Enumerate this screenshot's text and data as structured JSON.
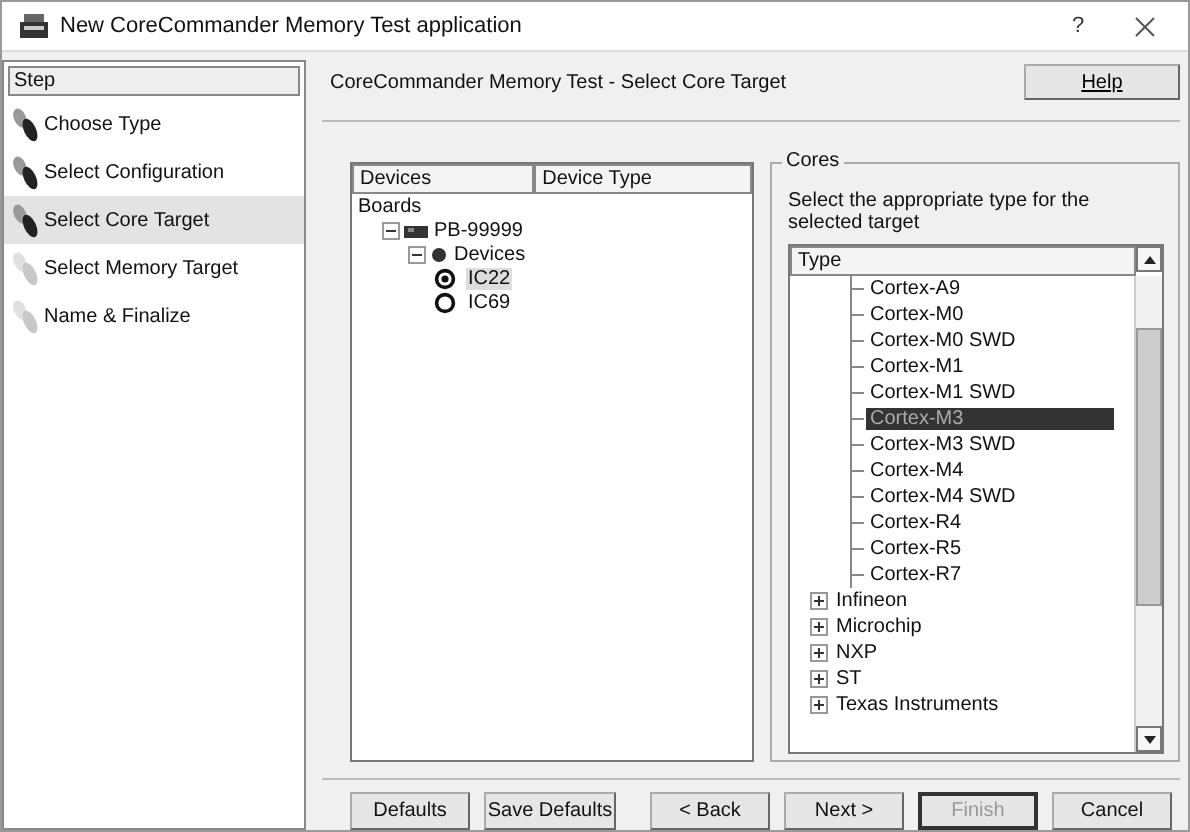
{
  "window": {
    "title": "New CoreCommander Memory Test application",
    "help_button": "?"
  },
  "steps": {
    "header": "Step",
    "items": [
      {
        "label": "Choose Type",
        "selected": false,
        "reached": true
      },
      {
        "label": "Select Configuration",
        "selected": false,
        "reached": true
      },
      {
        "label": "Select Core Target",
        "selected": true,
        "reached": true
      },
      {
        "label": "Select Memory Target",
        "selected": false,
        "reached": false
      },
      {
        "label": "Name & Finalize",
        "selected": false,
        "reached": false
      }
    ]
  },
  "page": {
    "title": "CoreCommander Memory Test - Select Core Target",
    "help": "Help"
  },
  "devices": {
    "columns": [
      "Devices",
      "Device Type"
    ],
    "tree": [
      {
        "label": "Boards",
        "kind": "root",
        "children": [
          {
            "label": "PB-99999",
            "kind": "board",
            "expanded": true,
            "children": [
              {
                "label": "Devices",
                "kind": "group",
                "expanded": true,
                "children": [
                  {
                    "label": "IC22",
                    "kind": "device",
                    "selected": true
                  },
                  {
                    "label": "IC69",
                    "kind": "device",
                    "selected": false
                  }
                ]
              }
            ]
          }
        ]
      }
    ]
  },
  "cores": {
    "title": "Cores",
    "hint": "Select the appropriate type for the selected target",
    "column": "Type",
    "items": [
      {
        "label": "Cortex-A9",
        "kind": "core",
        "selected": false
      },
      {
        "label": "Cortex-M0",
        "kind": "core",
        "selected": false
      },
      {
        "label": "Cortex-M0 SWD",
        "kind": "core",
        "selected": false
      },
      {
        "label": "Cortex-M1",
        "kind": "core",
        "selected": false
      },
      {
        "label": "Cortex-M1 SWD",
        "kind": "core",
        "selected": false
      },
      {
        "label": "Cortex-M3",
        "kind": "core",
        "selected": true
      },
      {
        "label": "Cortex-M3 SWD",
        "kind": "core",
        "selected": false
      },
      {
        "label": "Cortex-M4",
        "kind": "core",
        "selected": false
      },
      {
        "label": "Cortex-M4 SWD",
        "kind": "core",
        "selected": false
      },
      {
        "label": "Cortex-R4",
        "kind": "core",
        "selected": false
      },
      {
        "label": "Cortex-R5",
        "kind": "core",
        "selected": false
      },
      {
        "label": "Cortex-R7",
        "kind": "core",
        "selected": false
      },
      {
        "label": "Infineon",
        "kind": "vendor",
        "expanded": false
      },
      {
        "label": "Microchip",
        "kind": "vendor",
        "expanded": false
      },
      {
        "label": "NXP",
        "kind": "vendor",
        "expanded": false
      },
      {
        "label": "ST",
        "kind": "vendor",
        "expanded": false
      },
      {
        "label": "Texas Instruments",
        "kind": "vendor",
        "expanded": false
      }
    ]
  },
  "buttons": [
    {
      "label": "Defaults",
      "disabled": false,
      "default": false
    },
    {
      "label": "Save Defaults",
      "disabled": false,
      "default": false
    },
    {
      "label": "< Back",
      "disabled": false,
      "default": false
    },
    {
      "label": "Next >",
      "disabled": false,
      "default": false
    },
    {
      "label": "Finish",
      "disabled": true,
      "default": true
    },
    {
      "label": "Cancel",
      "disabled": false,
      "default": false
    }
  ]
}
